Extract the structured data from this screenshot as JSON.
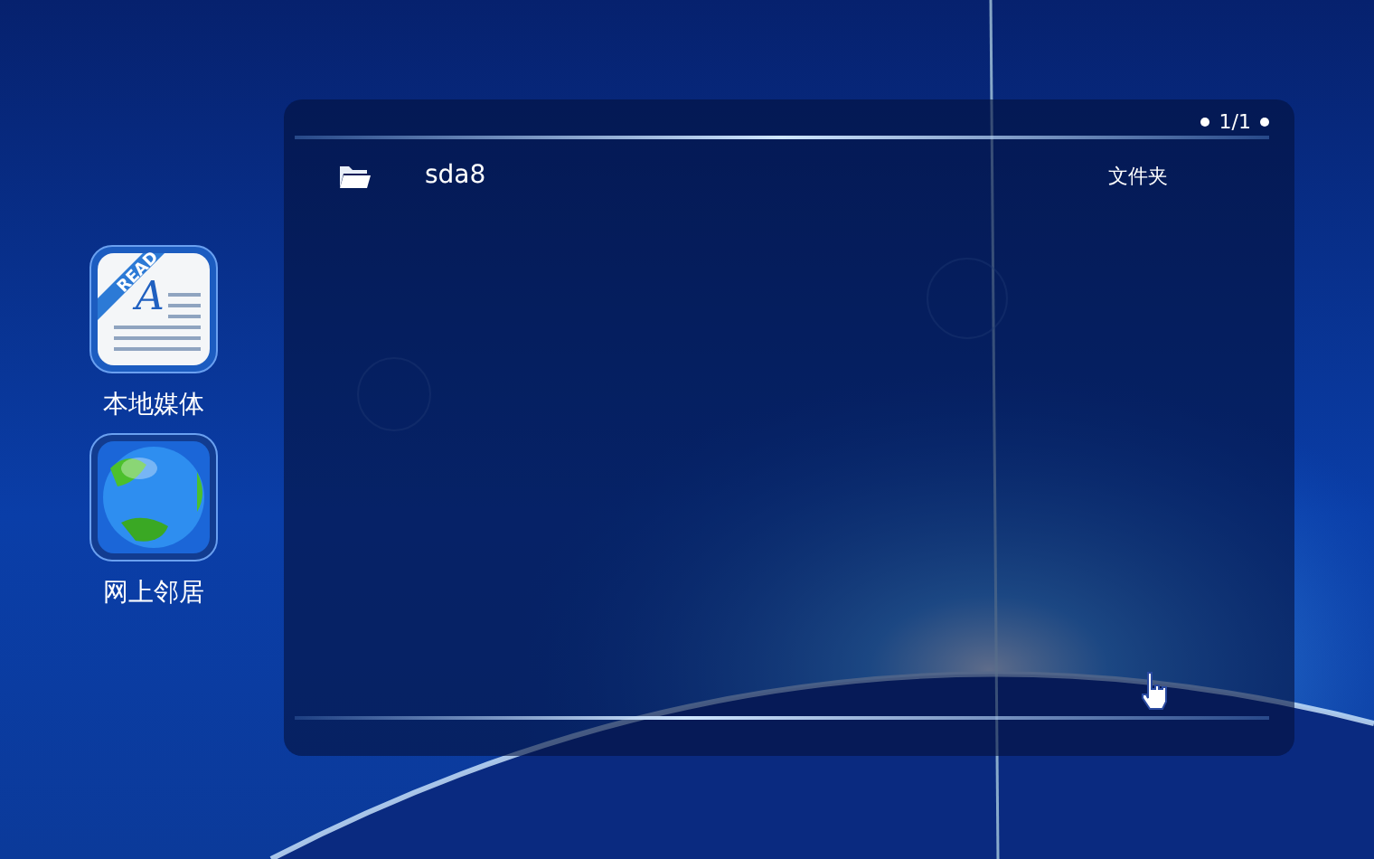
{
  "sidebar": {
    "items": [
      {
        "kind": "reader",
        "label": "本地媒体",
        "icon_badge": "READ",
        "icon_letter": "A"
      },
      {
        "kind": "globe",
        "label": "网上邻居"
      }
    ]
  },
  "browser": {
    "page_indicator": "1/1",
    "files": [
      {
        "kind": "folder",
        "name": "sda8",
        "type": "文件夹"
      }
    ]
  }
}
